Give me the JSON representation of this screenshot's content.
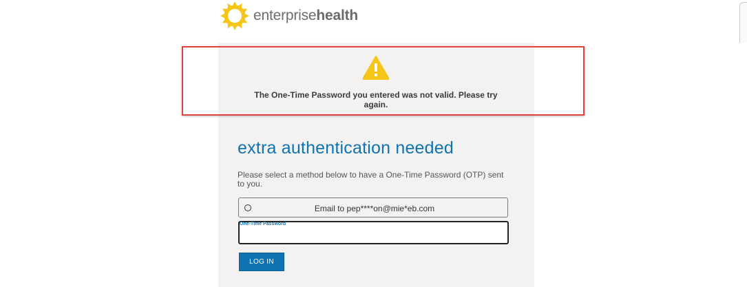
{
  "logo": {
    "text_regular": "enterprise",
    "text_bold": "health",
    "icon": "sun-logo-icon",
    "color": "#f5c518"
  },
  "alert": {
    "icon": "warning-icon",
    "icon_color": "#f5c518",
    "message": "The One-Time Password you entered was not valid. Please try again.",
    "outline_color": "#e0413f"
  },
  "main": {
    "heading": "extra authentication needed",
    "description": "Please select a method below to have a One-Time Password (OTP) sent to you.",
    "methods": [
      {
        "label": "Email to pep****on@mie*eb.com",
        "selected": false
      }
    ],
    "otp_field": {
      "label": "One-Time Password",
      "value": ""
    },
    "login_button": "LOG IN"
  },
  "colors": {
    "accent": "#0f72b1",
    "panel": "#f3f2f1"
  }
}
